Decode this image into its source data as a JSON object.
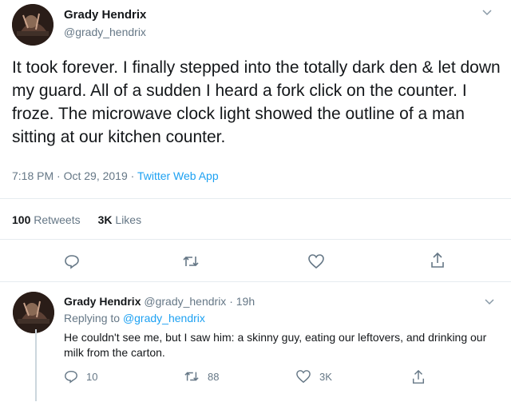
{
  "main_tweet": {
    "author_name": "Grady Hendrix",
    "author_handle": "@grady_hendrix",
    "text": "It took forever. I finally stepped into the totally dark den & let down my guard. All of a sudden I heard a fork click on the counter. I froze. The microwave clock light showed the outline of a man sitting at our kitchen counter.",
    "timestamp": "7:18 PM · Oct 29, 2019 · ",
    "source": "Twitter Web App",
    "retweets_count": "100",
    "retweets_label": "Retweets",
    "likes_count": "3K",
    "likes_label": "Likes",
    "actions": [
      "reply-icon",
      "retweet-icon",
      "like-icon",
      "share-icon"
    ]
  },
  "reply_tweet": {
    "author_name": "Grady Hendrix",
    "author_handle": "@grady_hendrix · 19h",
    "replying_prefix": "Replying to",
    "replying_to": "@grady_hendrix",
    "text": "He couldn't see me, but I saw him: a skinny guy, eating our leftovers, and drinking our milk from the carton.",
    "reply_count": "10",
    "retweet_count": "88",
    "like_count": "3K"
  },
  "colors": {
    "accent": "#1da1f2",
    "muted": "#657786",
    "text": "#14171a"
  }
}
